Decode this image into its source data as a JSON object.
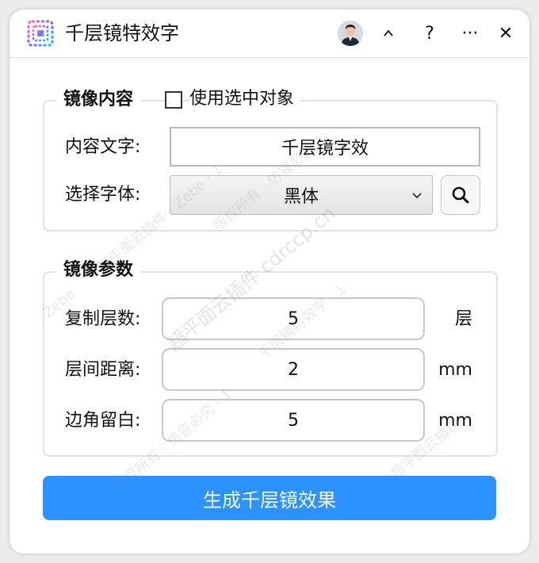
{
  "window": {
    "title": "千层镜特效字"
  },
  "titlebar": {
    "collapse_icon": "chevron-up",
    "help_label": "?",
    "more_label": "···",
    "close_label": "✕"
  },
  "mirror_content": {
    "group_title": "镜像内容",
    "use_selection_label": "使用选中对象",
    "use_selection_checked": false,
    "content_label": "内容文字:",
    "content_value": "千层镜字效",
    "font_label": "选择字体:",
    "font_value": "黑体"
  },
  "mirror_params": {
    "group_title": "镜像参数",
    "rows": [
      {
        "label": "复制层数:",
        "value": "5",
        "unit": "层"
      },
      {
        "label": "层间距离:",
        "value": "2",
        "unit": "mm"
      },
      {
        "label": "边角留白:",
        "value": "5",
        "unit": "mm"
      }
    ]
  },
  "actions": {
    "generate_label": "生成千层镜效果"
  },
  "watermarks": [
    "超平面云插件 cdrccp.cn",
    "版权所有 · 仿冒必究",
    "超平面云插件 · Zebe · 1",
    "千层镜特效字 · 1",
    "超平面云插件",
    "版权所有 · 仿冒必究 · 1",
    "Zebe"
  ],
  "colors": {
    "accent": "#2c92ff",
    "group_border": "#dfe3e8"
  }
}
